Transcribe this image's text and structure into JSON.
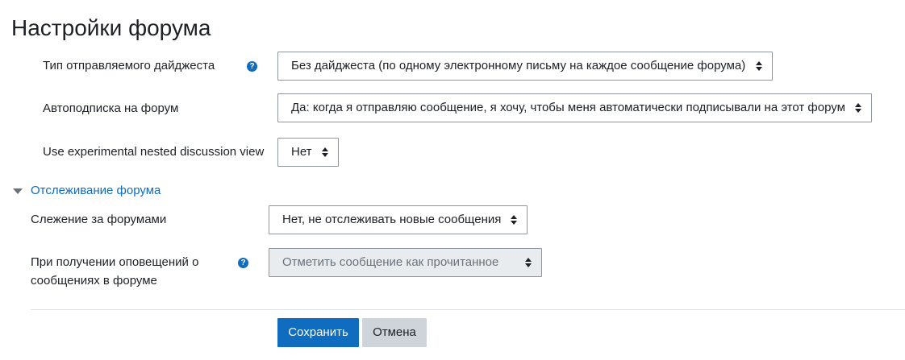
{
  "page": {
    "title": "Настройки форума"
  },
  "fields": {
    "digest_type": {
      "label": "Тип отправляемого дайджеста",
      "value": "Без дайджеста (по одному электронному письму на каждое сообщение форума)",
      "help_icon": "question-circle-icon"
    },
    "autosubscribe": {
      "label": "Автоподписка на форум",
      "value": "Да: когда я отправляю сообщение, я хочу, чтобы меня автоматически подписывали на этот форум"
    },
    "nested_view": {
      "label": "Use experimental nested discussion view",
      "value": "Нет"
    }
  },
  "tracking_section": {
    "title": "Отслеживание форума",
    "icon": "caret-down-icon",
    "fields": {
      "tracking": {
        "label": "Слежение за форумами",
        "value": "Нет, не отслеживать новые сообщения"
      },
      "mark_read": {
        "label_line1": "При получении оповещений о",
        "label_line2": "сообщениях в форуме",
        "value": "Отметить сообщение как прочитанное",
        "disabled": true,
        "help_icon": "question-circle-icon"
      }
    }
  },
  "actions": {
    "save": "Сохранить",
    "cancel": "Отмена"
  },
  "colors": {
    "primary": "#0f6cbf",
    "secondary_button": "#ced4da",
    "disabled_bg": "#e9ecef",
    "text": "#1d2125"
  }
}
